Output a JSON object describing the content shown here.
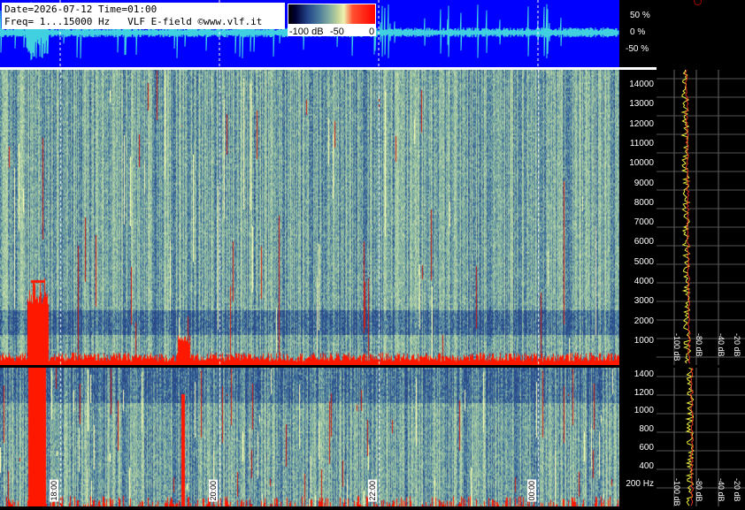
{
  "header": {
    "line1": "Date=2026-07-12 Time=01:00",
    "line2": "Freq= 1...15000 Hz   VLF E-field ©www.vlf.it"
  },
  "color_scale": {
    "labels": [
      "-100 dB",
      "-50",
      "0"
    ],
    "colors": [
      "#000000",
      "#224488",
      "#88b0a0",
      "#f0f0b0",
      "#ff0000"
    ]
  },
  "waveform": {
    "labels": [
      "50 %",
      "0 %",
      "-50 %"
    ],
    "background": "#0000ff",
    "trace_color": "#40d0e0"
  },
  "spectrogram_main": {
    "freq_labels": [
      "14000",
      "13000",
      "12000",
      "11000",
      "10000",
      "9000",
      "8000",
      "7000",
      "6000",
      "5000",
      "4000",
      "3000",
      "2000",
      "1000"
    ]
  },
  "spectrogram_low": {
    "freq_labels": [
      "1400",
      "1200",
      "1000",
      "800",
      "600",
      "400",
      "200 Hz"
    ]
  },
  "time_labels": [
    "18:00",
    "20:00",
    "22:00",
    "00:00"
  ],
  "profile_db_labels": [
    "-100 dB",
    "-80 dB",
    "-40 dB",
    "-20 dB"
  ]
}
